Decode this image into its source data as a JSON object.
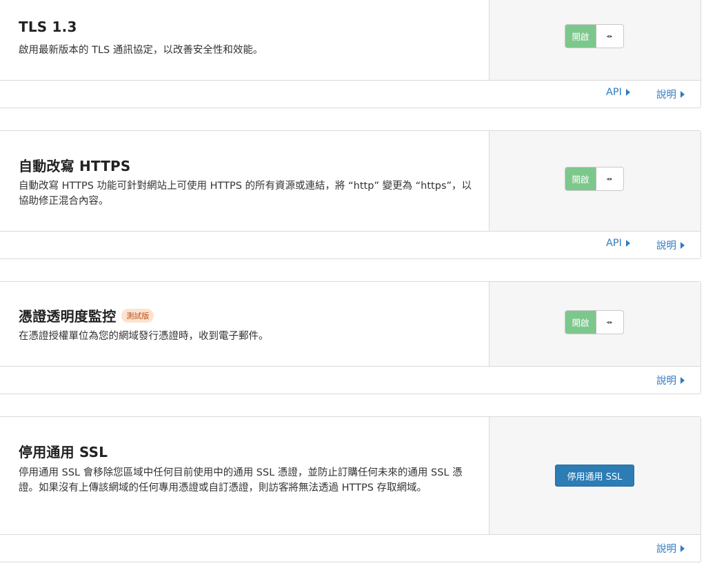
{
  "cards": [
    {
      "title": "TLS 1.3",
      "description": "啟用最新版本的 TLS 通訊協定，以改善安全性和效能。",
      "toggle_label": "開啟",
      "toggle_handle": "◂▸",
      "links": [
        "API",
        "說明"
      ]
    },
    {
      "title": "自動改寫 HTTPS",
      "description": "自動改寫 HTTPS 功能可針對網站上可使用 HTTPS 的所有資源或連結，將 “http” 變更為 “https”，以協助修正混合內容。",
      "toggle_label": "開啟",
      "toggle_handle": "◂▸",
      "links": [
        "API",
        "說明"
      ]
    },
    {
      "title": "憑證透明度監控",
      "badge": "測試版",
      "description": "在憑證授權單位為您的網域發行憑證時，收到電子郵件。",
      "toggle_label": "開啟",
      "toggle_handle": "◂▸",
      "links": [
        "說明"
      ]
    },
    {
      "title": "停用通用 SSL",
      "description": "停用通用 SSL 會移除您區域中任何目前使用中的通用 SSL 憑證，並防止訂購任何未來的通用 SSL 憑證。如果沒有上傳該網域的任何專用憑證或自訂憑證，則訪客將無法透過 HTTPS 存取網域。",
      "button_label": "停用通用 SSL",
      "links": [
        "說明"
      ]
    }
  ],
  "colors": {
    "toggle_on": "#7cc88c",
    "link": "#2f7bbf",
    "primary": "#2c7cb5",
    "badge_bg": "#fde2cf",
    "badge_text": "#b5531c"
  }
}
